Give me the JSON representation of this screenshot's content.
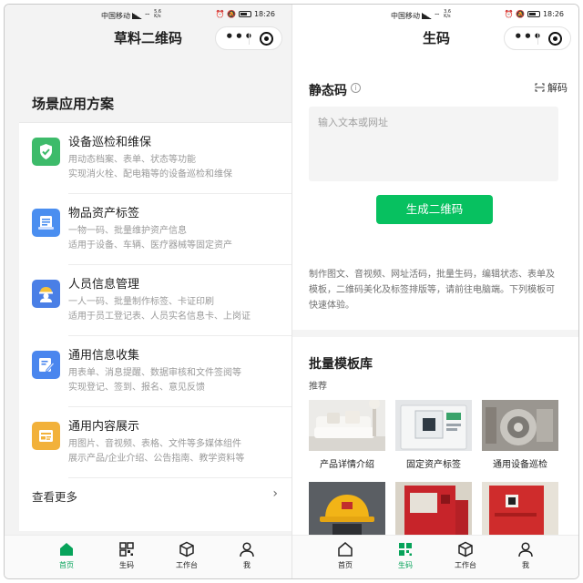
{
  "status_bar": {
    "carrier": "中国移动",
    "speed_left": [
      "5.6",
      "K/s"
    ],
    "speed_right": [
      "3.6",
      "K/s"
    ],
    "battery": "93",
    "time": "18:26"
  },
  "left": {
    "title": "草料二维码",
    "capsule": {
      "menu_icon": "more-dots-icon",
      "close_icon": "target-icon"
    },
    "section_title": "场景应用方案",
    "items": [
      {
        "title": "设备巡检和维保",
        "desc1": "用动态档案、表单、状态等功能",
        "desc2": "实现消火栓、配电箱等的设备巡检和维保",
        "icon": "shield-check-icon",
        "color": "#3dbb6a"
      },
      {
        "title": "物品资产标签",
        "desc1": "一物一码、批量维护资产信息",
        "desc2": "适用于设备、车辆、医疗器械等固定资产",
        "icon": "printer-tag-icon",
        "color": "#4a8ef0"
      },
      {
        "title": "人员信息管理",
        "desc1": "一人一码、批量制作标签、卡证印刷",
        "desc2": "适用于员工登记表、人员实名信息卡、上岗证",
        "icon": "worker-helmet-icon",
        "color": "#4a7fe6"
      },
      {
        "title": "通用信息收集",
        "desc1": "用表单、消息提醒、数据审核和文件签阅等",
        "desc2": "实现登记、签到、报名、意见反馈",
        "icon": "form-edit-icon",
        "color": "#4a86ee"
      },
      {
        "title": "通用内容展示",
        "desc1": "用图片、音视频、表格、文件等多媒体组件",
        "desc2": "展示产品/企业介绍、公告指南、教学资料等",
        "icon": "content-card-icon",
        "color": "#f2b13a"
      }
    ],
    "see_more": "查看更多",
    "active_tab": 0
  },
  "right": {
    "title": "生码",
    "static_code_title": "静态码",
    "decode_label": "解码",
    "input_placeholder": "输入文本或网址",
    "generate_button": "生成二维码",
    "tip_lines": [
      "制作图文、音视频、网址活码，批量生码，编辑状态、表单及",
      "模板，二维码美化及标签排版等，请前往电脑端。下列模板可",
      "快速体验。"
    ],
    "batch_title": "批量模板库",
    "recommend_label": "推荐",
    "templates": [
      {
        "name": "产品详情介绍"
      },
      {
        "name": "固定资产标签"
      },
      {
        "name": "通用设备巡检"
      }
    ],
    "active_tab": 1
  },
  "tabs": [
    {
      "label": "首页",
      "icon": "home-icon"
    },
    {
      "label": "生码",
      "icon": "qr-grid-icon"
    },
    {
      "label": "工作台",
      "icon": "cube-box-icon"
    },
    {
      "label": "我",
      "icon": "person-icon"
    }
  ],
  "colors": {
    "accent_green": "#07c160",
    "active_tab_green": "#07a35a",
    "hint_gray": "#9a9a9a"
  }
}
